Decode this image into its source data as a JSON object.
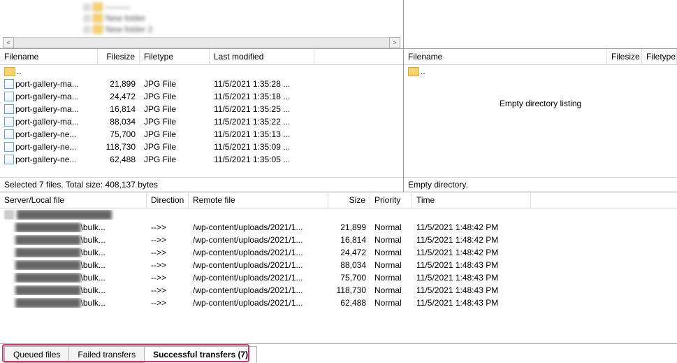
{
  "tree": {
    "items": [
      "———",
      "New folder",
      "New folder 2"
    ]
  },
  "local": {
    "columns": {
      "filename": "Filename",
      "filesize": "Filesize",
      "filetype": "Filetype",
      "modified": "Last modified"
    },
    "parent": "..",
    "files": [
      {
        "name": "port-gallery-ma...",
        "size": "21,899",
        "type": "JPG File",
        "modified": "11/5/2021 1:35:28 ..."
      },
      {
        "name": "port-gallery-ma...",
        "size": "24,472",
        "type": "JPG File",
        "modified": "11/5/2021 1:35:18 ..."
      },
      {
        "name": "port-gallery-ma...",
        "size": "16,814",
        "type": "JPG File",
        "modified": "11/5/2021 1:35:25 ..."
      },
      {
        "name": "port-gallery-ma...",
        "size": "88,034",
        "type": "JPG File",
        "modified": "11/5/2021 1:35:22 ..."
      },
      {
        "name": "port-gallery-ne...",
        "size": "75,700",
        "type": "JPG File",
        "modified": "11/5/2021 1:35:13 ..."
      },
      {
        "name": "port-gallery-ne...",
        "size": "118,730",
        "type": "JPG File",
        "modified": "11/5/2021 1:35:09 ..."
      },
      {
        "name": "port-gallery-ne...",
        "size": "62,488",
        "type": "JPG File",
        "modified": "11/5/2021 1:35:05 ..."
      }
    ],
    "status": "Selected 7 files. Total size: 408,137 bytes"
  },
  "remote": {
    "columns": {
      "filename": "Filename",
      "filesize": "Filesize",
      "filetype": "Filetype"
    },
    "parent": "..",
    "empty_message": "Empty directory listing",
    "status": "Empty directory."
  },
  "queue": {
    "columns": {
      "server": "Server/Local file",
      "direction": "Direction",
      "remote": "Remote file",
      "size": "Size",
      "priority": "Priority",
      "time": "Time"
    },
    "host_row": "████████████████",
    "rows": [
      {
        "local": "███████████\\bulk...",
        "dir": "-->>",
        "remote": "/wp-content/uploads/2021/1...",
        "size": "21,899",
        "priority": "Normal",
        "time": "11/5/2021 1:48:42 PM"
      },
      {
        "local": "███████████\\bulk...",
        "dir": "-->>",
        "remote": "/wp-content/uploads/2021/1...",
        "size": "16,814",
        "priority": "Normal",
        "time": "11/5/2021 1:48:42 PM"
      },
      {
        "local": "███████████\\bulk...",
        "dir": "-->>",
        "remote": "/wp-content/uploads/2021/1...",
        "size": "24,472",
        "priority": "Normal",
        "time": "11/5/2021 1:48:42 PM"
      },
      {
        "local": "███████████\\bulk...",
        "dir": "-->>",
        "remote": "/wp-content/uploads/2021/1...",
        "size": "88,034",
        "priority": "Normal",
        "time": "11/5/2021 1:48:43 PM"
      },
      {
        "local": "███████████\\bulk...",
        "dir": "-->>",
        "remote": "/wp-content/uploads/2021/1...",
        "size": "75,700",
        "priority": "Normal",
        "time": "11/5/2021 1:48:43 PM"
      },
      {
        "local": "███████████\\bulk...",
        "dir": "-->>",
        "remote": "/wp-content/uploads/2021/1...",
        "size": "118,730",
        "priority": "Normal",
        "time": "11/5/2021 1:48:43 PM"
      },
      {
        "local": "███████████\\bulk...",
        "dir": "-->>",
        "remote": "/wp-content/uploads/2021/1...",
        "size": "62,488",
        "priority": "Normal",
        "time": "11/5/2021 1:48:43 PM"
      }
    ]
  },
  "tabs": {
    "queued": "Queued files",
    "failed": "Failed transfers",
    "success": "Successful transfers (7)"
  }
}
